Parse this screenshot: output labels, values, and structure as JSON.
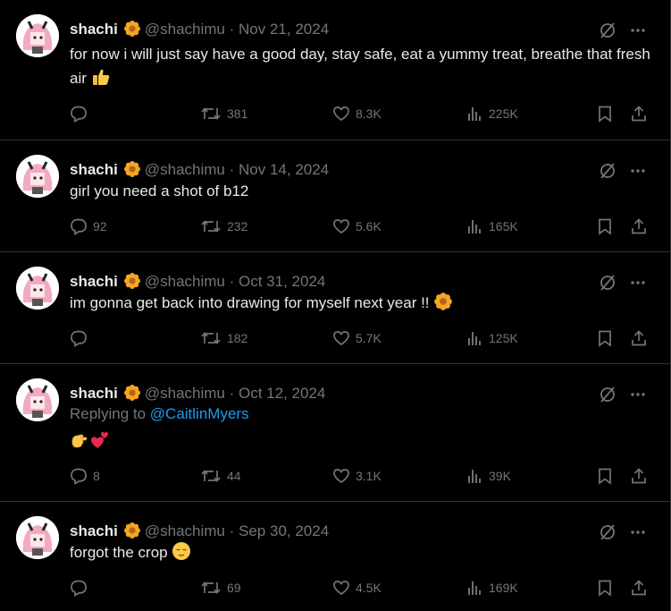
{
  "author": {
    "name": "shachi",
    "handle": "@shachimu",
    "dot": "·"
  },
  "tweets": [
    {
      "date": "Nov 21, 2024",
      "text": "for now i will just say have a good day, stay safe, eat a yummy treat, breathe that fresh air",
      "emoji": "thumbs-up",
      "replies": "",
      "retweets": "381",
      "likes": "8.3K",
      "views": "225K"
    },
    {
      "date": "Nov 14, 2024",
      "text": "girl you need a shot of b12",
      "replies": "92",
      "retweets": "232",
      "likes": "5.6K",
      "views": "165K"
    },
    {
      "date": "Oct 31, 2024",
      "text": "im gonna get back into drawing for myself next year !!",
      "emoji": "blossom",
      "replies": "",
      "retweets": "182",
      "likes": "5.7K",
      "views": "125K"
    },
    {
      "date": "Oct 12, 2024",
      "replying_prefix": "Replying to ",
      "replying_to": "@CaitlinMyers",
      "emoji": "pinching-hand + two-hearts",
      "replies": "8",
      "retweets": "44",
      "likes": "3.1K",
      "views": "39K"
    },
    {
      "date": "Sep 30, 2024",
      "text": "forgot the crop",
      "emoji": "relieved-face",
      "replies": "",
      "retweets": "69",
      "likes": "4.5K",
      "views": "169K"
    }
  ],
  "colors": {
    "background": "#000000",
    "text": "#e7e9ea",
    "muted": "#71767b",
    "link": "#1d9bf0",
    "border": "#2f3336"
  }
}
